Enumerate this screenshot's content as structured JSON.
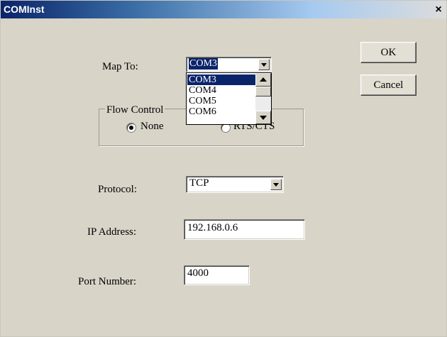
{
  "window": {
    "title": "COMInst",
    "close_label": "×"
  },
  "buttons": {
    "ok": "OK",
    "cancel": "Cancel"
  },
  "map_to": {
    "label": "Map To:",
    "value": "COM3",
    "options": [
      "COM3",
      "COM4",
      "COM5",
      "COM6"
    ],
    "selected_index": 0
  },
  "flow_control": {
    "title": "Flow Control",
    "options": [
      {
        "label": "None",
        "checked": true
      },
      {
        "label": "RTS/CTS",
        "checked": false
      }
    ]
  },
  "protocol": {
    "label": "Protocol:",
    "value": "TCP"
  },
  "ip_address": {
    "label": "IP Address:",
    "value": "192.168.0.6"
  },
  "port_number": {
    "label": "Port Number:",
    "value": "4000"
  }
}
